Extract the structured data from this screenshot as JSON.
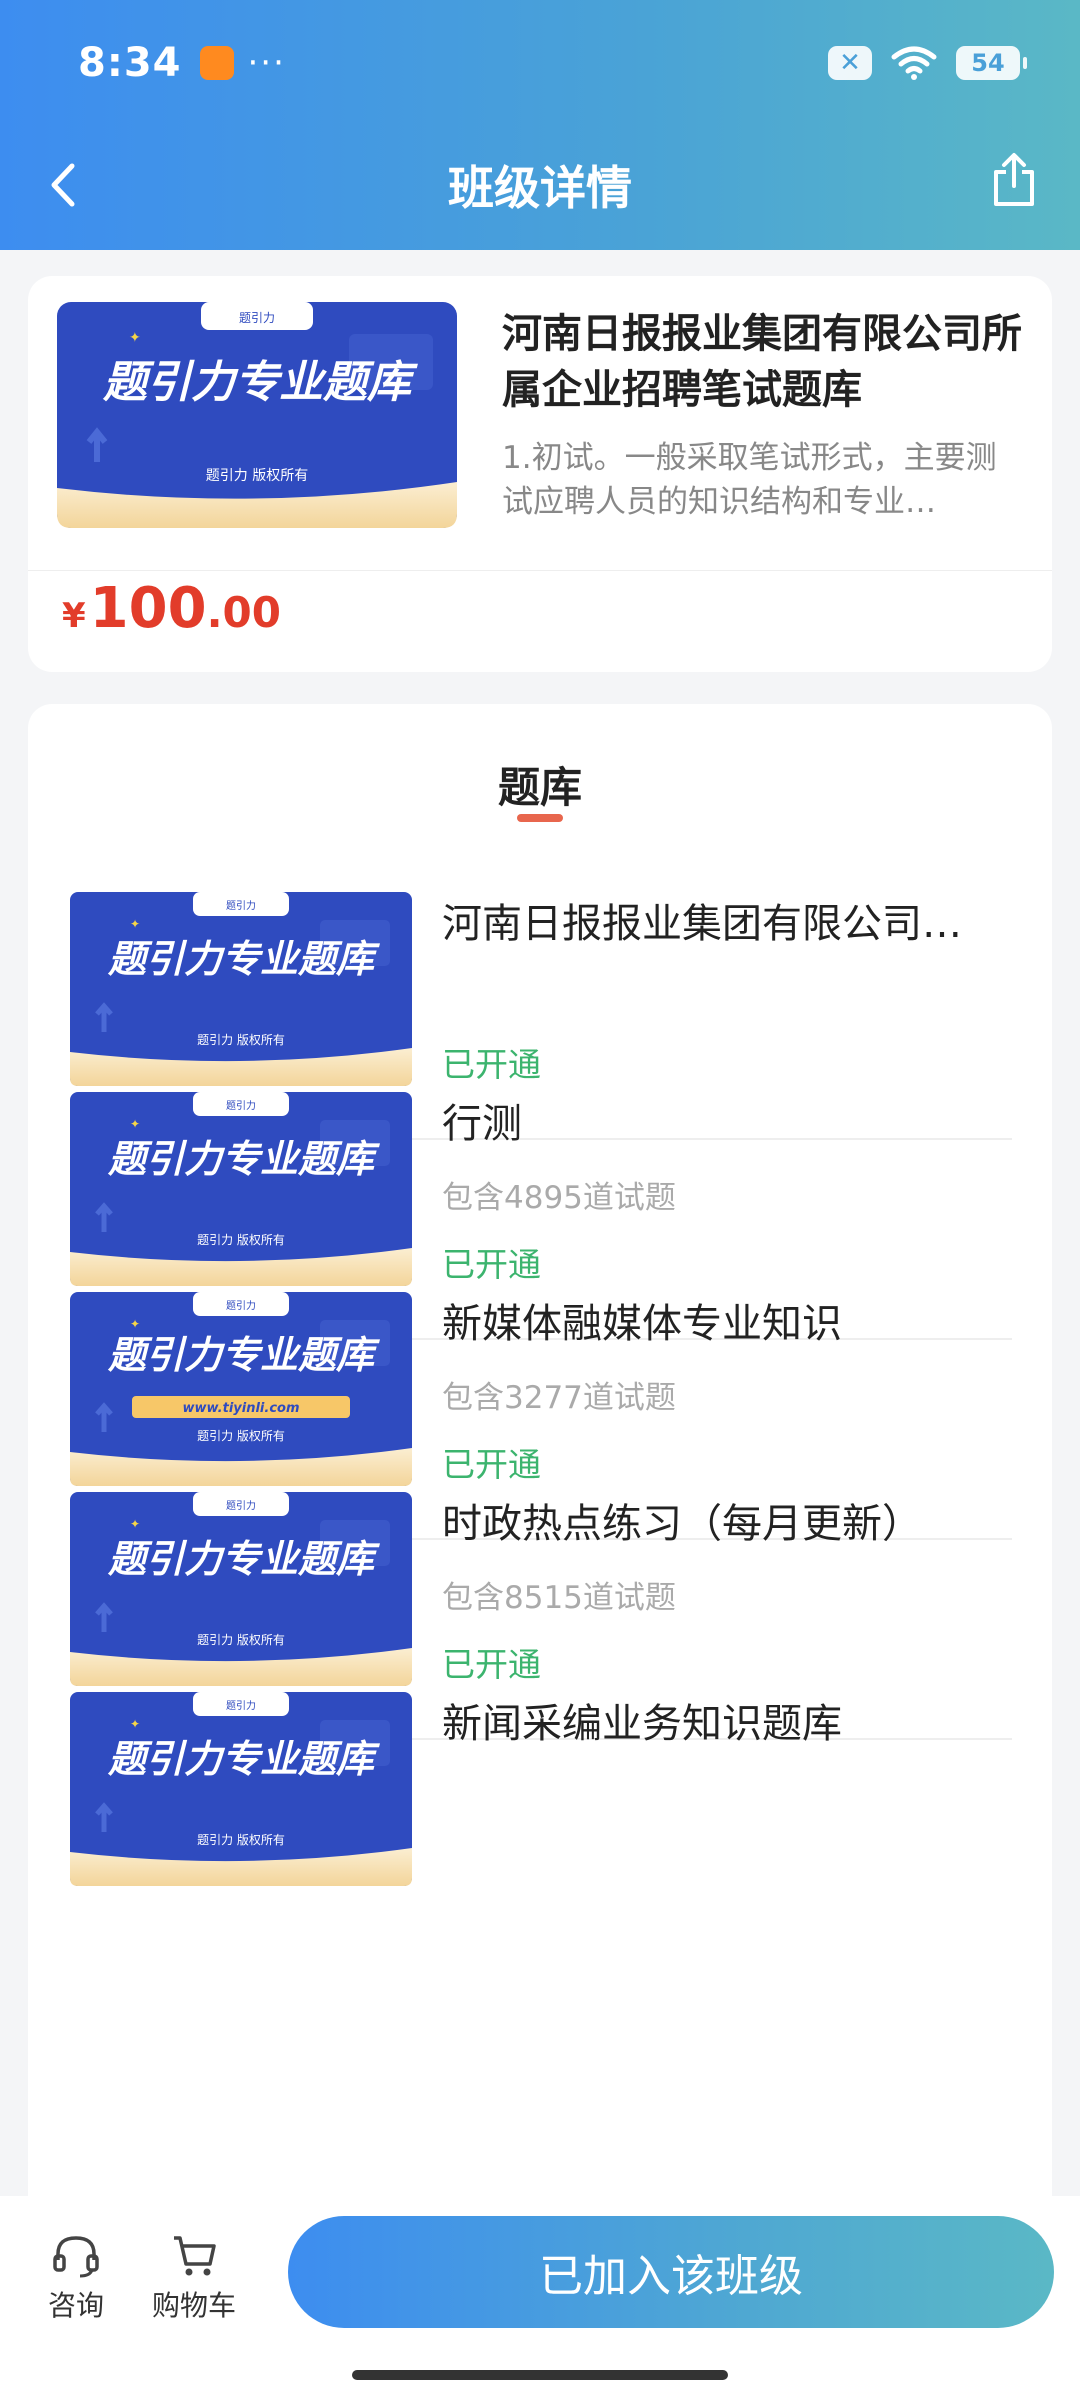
{
  "status_bar": {
    "time": "8:34",
    "more": "···",
    "battery": "54"
  },
  "header": {
    "title": "班级详情"
  },
  "class_card": {
    "title": "河南日报报业集团有限公司所属企业招聘笔试题库",
    "description": "1.初试。一般采取笔试形式，主要测试应聘人员的知识结构和专业…",
    "price_symbol": "¥",
    "price_int": "100",
    "price_dec": ".00"
  },
  "cover": {
    "logo_text": "题引力",
    "main_text": "题引力专业题库",
    "footer_text": "题引力 版权所有",
    "url_text": "www.tiyinli.com"
  },
  "bank_section": {
    "title": "题库",
    "items": [
      {
        "name": "河南日报报业集团有限公司…",
        "count": "",
        "status": "已开通"
      },
      {
        "name": "行测",
        "count": "包含4895道试题",
        "status": "已开通"
      },
      {
        "name": "新媒体融媒体专业知识",
        "count": "包含3277道试题",
        "status": "已开通"
      },
      {
        "name": "时政热点练习（每月更新）",
        "count": "包含8515道试题",
        "status": "已开通"
      },
      {
        "name": "新闻采编业务知识题库",
        "count": "",
        "status": ""
      }
    ]
  },
  "bottom_bar": {
    "consult_label": "咨询",
    "cart_label": "购物车",
    "join_label": "已加入该班级"
  },
  "colors": {
    "accent": "#3d8df0",
    "price": "#e23c2a",
    "opened": "#3cb46e",
    "cover_blue": "#2f4bbf"
  }
}
